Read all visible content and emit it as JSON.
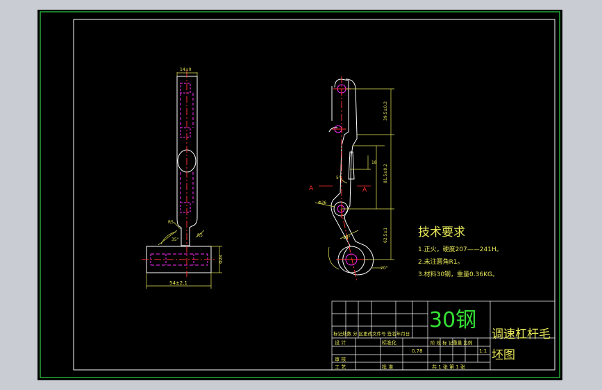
{
  "colors": {
    "background": "#000000",
    "outer_frame": "#2fd24a",
    "geometry": "#ffffff",
    "hidden_lines": "#ff2bff",
    "dimensions": "#e8e85a",
    "center_lines": "#ff3030",
    "material_text": "#35e035"
  },
  "drawing": {
    "material": "30钢",
    "title_line1": "调速杠杆毛",
    "title_line2": "坯图",
    "tech_req": {
      "heading": "技术要求",
      "item1": "1.正火，硬度207——241H。",
      "item2": "2.未注圆角R1。",
      "item3": "3.材料30钢，重量0.36KG。"
    }
  },
  "title_block": {
    "row_markers": "标记处数 分 区更改文件号 签名年月日",
    "design": "设 计",
    "standardize": "标准化",
    "stage_labels": "阶 段 标 记重量 比例",
    "weight": "0.78",
    "scale": "1:1",
    "review": "审 核",
    "process": "工 艺",
    "approve": "批 准",
    "sheet_info": "共 1 张  第 1 张"
  },
  "dimensions": {
    "top_width": "14±0",
    "bottom_width": "54±2.1",
    "boss_height": "Φ28",
    "r_left": "R5",
    "r_right": "R5",
    "angle_left": "35°",
    "side_h1": "39.5±0.2",
    "side_h2": "81.5±0.2",
    "side_h3": "62.5±1",
    "small_h": "18",
    "angle_side": "5°",
    "section_left": "A",
    "section_right": "A",
    "hole_dia": "Φ26",
    "angle_bottom": "20°",
    "angle_mid": "18°"
  }
}
